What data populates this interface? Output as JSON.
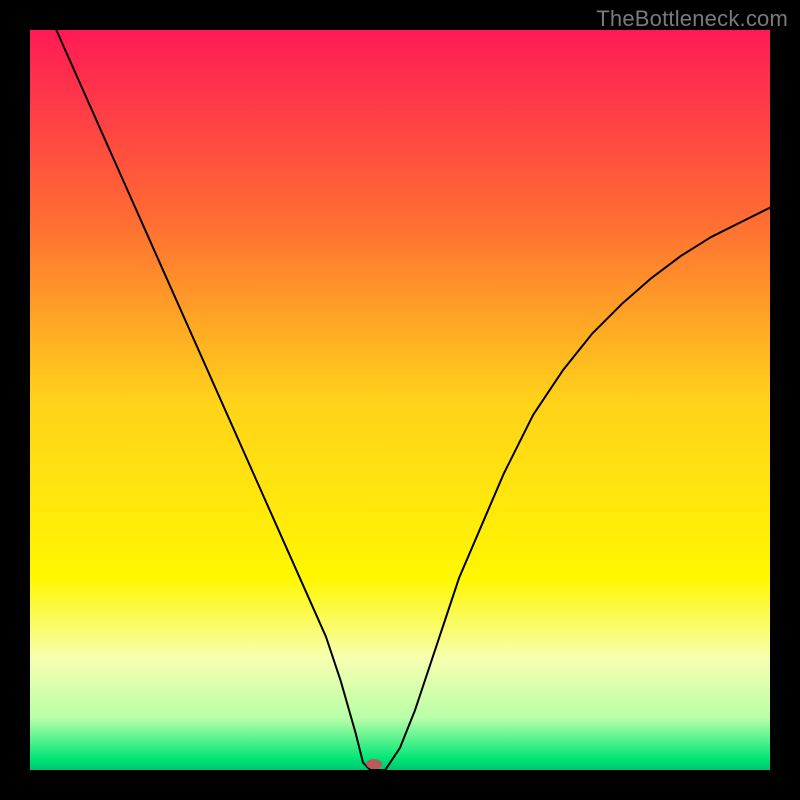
{
  "watermark": "TheBottleneck.com",
  "chart_data": {
    "type": "line",
    "title": "",
    "xlabel": "",
    "ylabel": "",
    "xlim": [
      0,
      100
    ],
    "ylim": [
      0,
      100
    ],
    "grid": false,
    "legend": false,
    "background_gradient": {
      "stops": [
        {
          "pos": 0.0,
          "color": "#ff1a55"
        },
        {
          "pos": 0.25,
          "color": "#ff6a33"
        },
        {
          "pos": 0.5,
          "color": "#ffd21a"
        },
        {
          "pos": 0.74,
          "color": "#fff700"
        },
        {
          "pos": 0.85,
          "color": "#f6ffb0"
        },
        {
          "pos": 0.93,
          "color": "#b8ffa8"
        },
        {
          "pos": 0.985,
          "color": "#00e676"
        },
        {
          "pos": 1.0,
          "color": "#00c472"
        }
      ]
    },
    "series": [
      {
        "name": "bottleneck-curve",
        "color": "#000000",
        "width": 2,
        "x": [
          0,
          4,
          8,
          12,
          16,
          20,
          24,
          28,
          32,
          36,
          40,
          42,
          44,
          45,
          46,
          47,
          48,
          50,
          52,
          54,
          56,
          58,
          61,
          64,
          68,
          72,
          76,
          80,
          84,
          88,
          92,
          96,
          100
        ],
        "y": [
          108,
          99,
          90,
          81,
          72,
          63,
          54,
          45,
          36,
          27,
          18,
          12,
          5,
          1,
          0,
          0,
          0,
          3,
          8,
          14,
          20,
          26,
          33,
          40,
          48,
          54,
          59,
          63,
          66.5,
          69.5,
          72,
          74,
          76
        ]
      }
    ],
    "marker": {
      "name": "optimal-point",
      "x": 46.5,
      "y": 0.8,
      "color": "#b75a5a",
      "rx": 8,
      "ry": 5
    }
  }
}
